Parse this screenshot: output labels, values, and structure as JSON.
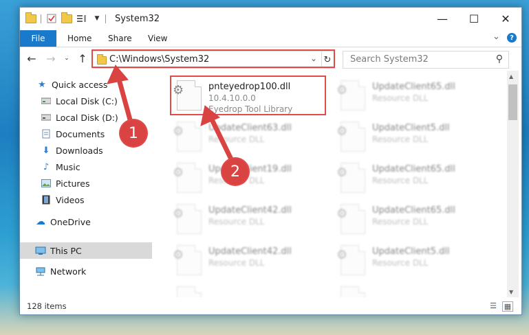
{
  "window": {
    "title": "System32",
    "controls": {
      "minimize": "—",
      "maximize": "☐",
      "close": "✕"
    }
  },
  "ribbon": {
    "tabs": [
      "File",
      "Home",
      "Share",
      "View"
    ],
    "help": "?"
  },
  "navigation": {
    "address": "C:\\Windows\\System32",
    "search_placeholder": "Search System32"
  },
  "sidebar": {
    "items": [
      {
        "label": "Quick access",
        "icon": "star-icon",
        "pinned": false
      },
      {
        "label": "Local Disk (C:)",
        "icon": "drive-icon",
        "pinned": true
      },
      {
        "label": "Local Disk (D:)",
        "icon": "drive-icon",
        "pinned": true
      },
      {
        "label": "Documents",
        "icon": "documents-icon",
        "pinned": true
      },
      {
        "label": "Downloads",
        "icon": "downloads-icon",
        "pinned": true
      },
      {
        "label": "Music",
        "icon": "music-icon",
        "pinned": true
      },
      {
        "label": "Pictures",
        "icon": "pictures-icon",
        "pinned": true
      },
      {
        "label": "Videos",
        "icon": "videos-icon",
        "pinned": true
      },
      {
        "label": "OneDrive",
        "icon": "onedrive-icon",
        "pinned": false
      },
      {
        "label": "This PC",
        "icon": "pc-icon",
        "pinned": false,
        "selected": true
      },
      {
        "label": "Network",
        "icon": "network-icon",
        "pinned": false
      }
    ]
  },
  "files": [
    {
      "name": "pnteyedrop100.dll",
      "line2": "10.4.10.0.0",
      "line3": "Eyedrop Tool Library",
      "highlighted": true
    },
    {
      "name": "UpdateClient65.dll",
      "line2": "Resource DLL",
      "line3": ""
    },
    {
      "name": "UpdateClient63.dll",
      "line2": "Resource DLL",
      "line3": ""
    },
    {
      "name": "UpdateClient5.dll",
      "line2": "Resource DLL",
      "line3": ""
    },
    {
      "name": "UpdateClient19.dll",
      "line2": "Resource DLL",
      "line3": ""
    },
    {
      "name": "UpdateClient65.dll",
      "line2": "Resource DLL",
      "line3": ""
    },
    {
      "name": "UpdateClient42.dll",
      "line2": "Resource DLL",
      "line3": ""
    },
    {
      "name": "UpdateClient65.dll",
      "line2": "Resource DLL",
      "line3": ""
    },
    {
      "name": "UpdateClient42.dll",
      "line2": "Resource DLL",
      "line3": ""
    },
    {
      "name": "UpdateClient5.dll",
      "line2": "Resource DLL",
      "line3": ""
    }
  ],
  "status": {
    "item_count": "128 items"
  },
  "callouts": [
    {
      "label": "1"
    },
    {
      "label": "2"
    }
  ],
  "colors": {
    "accent": "#1979ca",
    "highlight": "#e04a48",
    "selected_bg": "#d9d9d9"
  }
}
